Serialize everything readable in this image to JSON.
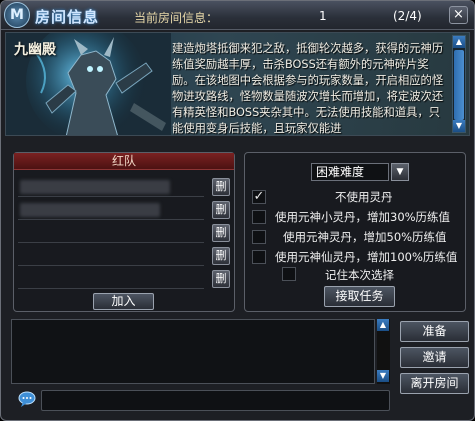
{
  "header": {
    "emblem_glyph": "M",
    "title": "房间信息",
    "room_info_label": "当前房间信息：",
    "room_number": "1",
    "room_count": "(2/4)",
    "close_glyph": "×"
  },
  "banner": {
    "boss_name": "九幽殿",
    "description": "建造炮塔抵御来犯之敌，抵御轮次越多，获得的元神历练值奖励越丰厚，击杀BOSS还有额外的元神碎片奖励。在该地图中会根据参与的玩家数量，开启相应的怪物进攻路线，怪物数量随波次增长而增加，将定波次还有精英怪和BOSS夹杂其中。无法使用技能和道具，只能使用变身后技能，且玩家仅能进"
  },
  "team": {
    "header": "红队",
    "kick_label": "删",
    "join_label": "加入",
    "slots": [
      "",
      "",
      "",
      "",
      ""
    ]
  },
  "options": {
    "difficulty": "困难难度",
    "dropdown_glyph": "▼",
    "check_glyph": "✓",
    "items": [
      {
        "label": "不使用灵丹",
        "checked": true
      },
      {
        "label": "使用元神小灵丹，增加30%历练值",
        "checked": false
      },
      {
        "label": "使用元神灵丹，增加50%历练值",
        "checked": false
      },
      {
        "label": "使用元神仙灵丹，增加100%历练值",
        "checked": false
      }
    ],
    "remember_label": "记住本次选择",
    "accept_label": "接取任务"
  },
  "actions": {
    "ready_label": "准备",
    "invite_label": "邀请",
    "leave_label": "离开房间"
  },
  "chat": {
    "input_value": "",
    "scroll_up_glyph": "▲",
    "scroll_down_glyph": "▼"
  },
  "icons": {
    "emblem": "shield-emblem-icon",
    "close": "close-icon",
    "chat": "speech-bubble-icon"
  },
  "colors": {
    "team_header": "#7a2222",
    "title_text": "#cfe6ff",
    "scroll_accent": "#3a7cc0"
  }
}
